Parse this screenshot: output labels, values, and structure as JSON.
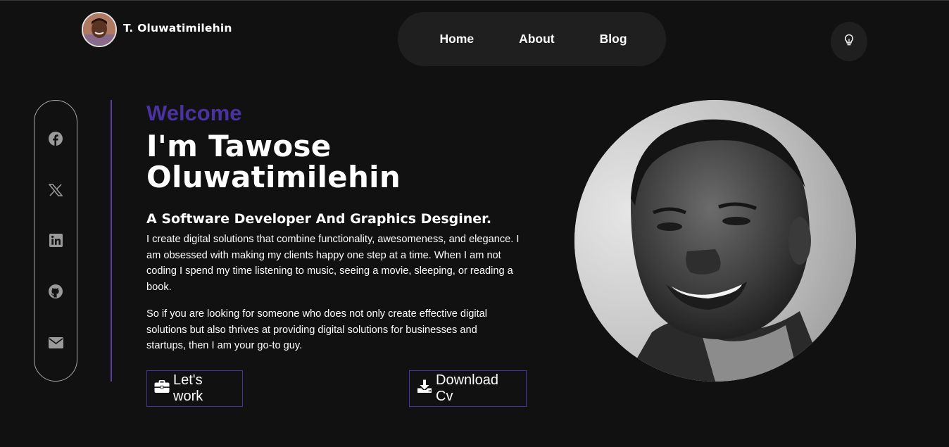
{
  "brand": {
    "name": "T. Oluwatimilehin",
    "avatar_icon": "profile-photo"
  },
  "nav": {
    "items": [
      {
        "label": "Home"
      },
      {
        "label": "About"
      },
      {
        "label": "Blog"
      }
    ]
  },
  "theme_toggle": {
    "icon": "lightbulb-icon"
  },
  "social": [
    {
      "name": "facebook",
      "icon": "facebook-icon"
    },
    {
      "name": "x",
      "icon": "x-icon"
    },
    {
      "name": "linkedin",
      "icon": "linkedin-icon"
    },
    {
      "name": "github",
      "icon": "github-icon"
    },
    {
      "name": "email",
      "icon": "envelope-icon"
    }
  ],
  "hero": {
    "welcome": "Welcome",
    "name_line1": "I'm Tawose",
    "name_line2": "Oluwatimilehin",
    "role": "A Software Developer And Graphics Desginer.",
    "paragraph1": "I create digital solutions that combine functionality, awesomeness, and elegance. I am obsessed with making my clients happy one step at a time. When I am not coding I spend my time listening to music, seeing a movie, sleeping, or reading a book.",
    "paragraph2": "So if you are looking for someone who does not only create effective digital solutions but also thrives at providing digital solutions for businesses and startups, then I am your go-to guy.",
    "work_button": "Let's work",
    "cv_button": "Download Cv"
  },
  "colors": {
    "accent": "#4a33a0",
    "background": "#111112",
    "nav_bg": "#1f1f1f"
  }
}
